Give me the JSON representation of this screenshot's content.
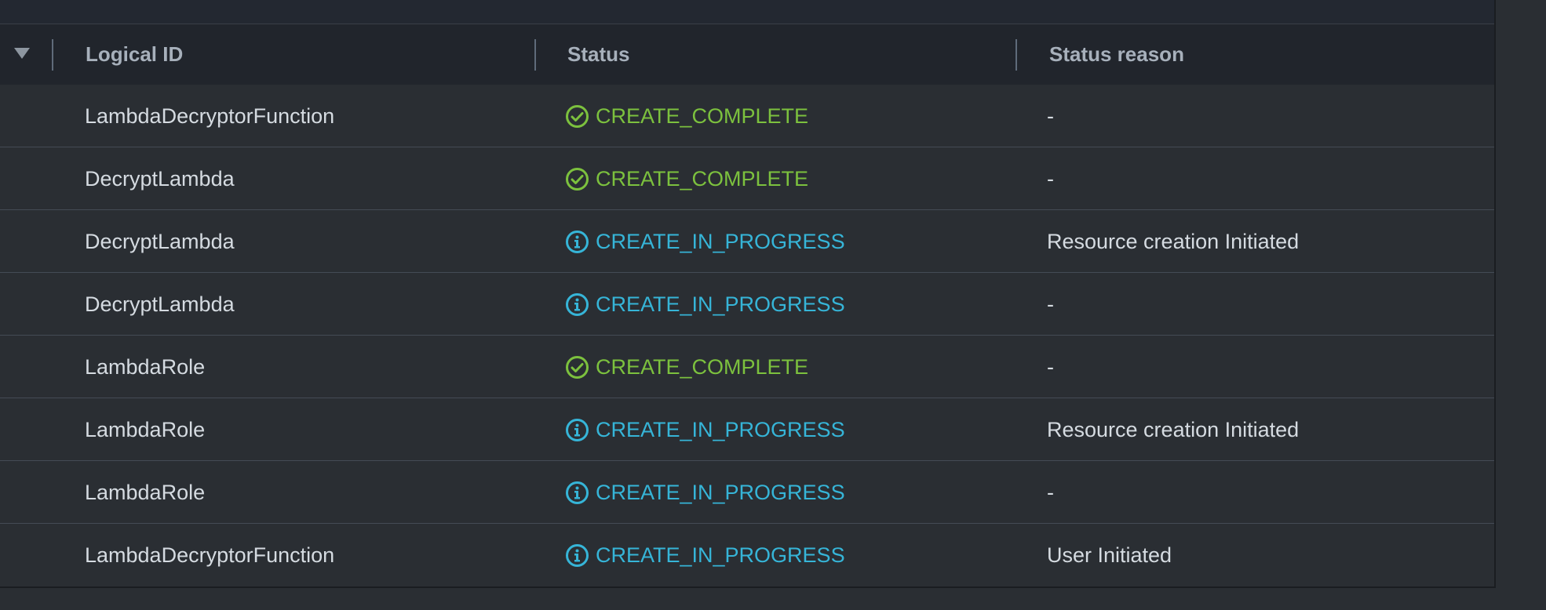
{
  "header": {
    "col_logical_id": "Logical ID",
    "col_status": "Status",
    "col_status_reason": "Status reason"
  },
  "colors": {
    "complete": "#7cc13e",
    "in_progress": "#36b5d8"
  },
  "rows": [
    {
      "logical_id": "LambdaDecryptorFunction",
      "status": "CREATE_COMPLETE",
      "status_type": "complete",
      "icon": "check-circle-icon",
      "reason": "-"
    },
    {
      "logical_id": "DecryptLambda",
      "status": "CREATE_COMPLETE",
      "status_type": "complete",
      "icon": "check-circle-icon",
      "reason": "-"
    },
    {
      "logical_id": "DecryptLambda",
      "status": "CREATE_IN_PROGRESS",
      "status_type": "progress",
      "icon": "info-circle-icon",
      "reason": "Resource creation Initiated"
    },
    {
      "logical_id": "DecryptLambda",
      "status": "CREATE_IN_PROGRESS",
      "status_type": "progress",
      "icon": "info-circle-icon",
      "reason": "-"
    },
    {
      "logical_id": "LambdaRole",
      "status": "CREATE_COMPLETE",
      "status_type": "complete",
      "icon": "check-circle-icon",
      "reason": "-"
    },
    {
      "logical_id": "LambdaRole",
      "status": "CREATE_IN_PROGRESS",
      "status_type": "progress",
      "icon": "info-circle-icon",
      "reason": "Resource creation Initiated"
    },
    {
      "logical_id": "LambdaRole",
      "status": "CREATE_IN_PROGRESS",
      "status_type": "progress",
      "icon": "info-circle-icon",
      "reason": "-"
    },
    {
      "logical_id": "LambdaDecryptorFunction",
      "status": "CREATE_IN_PROGRESS",
      "status_type": "progress",
      "icon": "info-circle-icon",
      "reason": "User Initiated"
    }
  ]
}
